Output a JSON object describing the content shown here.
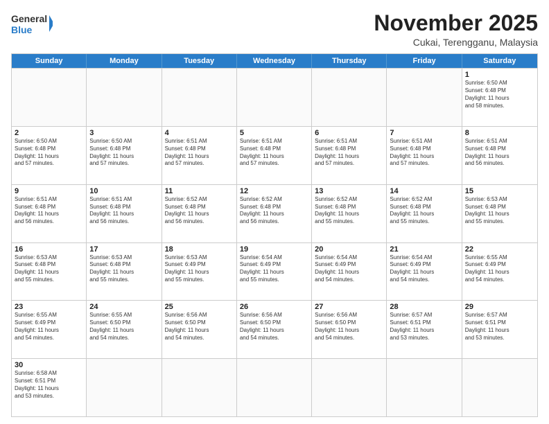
{
  "header": {
    "logo_general": "General",
    "logo_blue": "Blue",
    "month_title": "November 2025",
    "location": "Cukai, Terengganu, Malaysia"
  },
  "weekdays": [
    "Sunday",
    "Monday",
    "Tuesday",
    "Wednesday",
    "Thursday",
    "Friday",
    "Saturday"
  ],
  "weeks": [
    [
      {
        "day": "",
        "info": ""
      },
      {
        "day": "",
        "info": ""
      },
      {
        "day": "",
        "info": ""
      },
      {
        "day": "",
        "info": ""
      },
      {
        "day": "",
        "info": ""
      },
      {
        "day": "",
        "info": ""
      },
      {
        "day": "1",
        "info": "Sunrise: 6:50 AM\nSunset: 6:48 PM\nDaylight: 11 hours\nand 58 minutes."
      }
    ],
    [
      {
        "day": "2",
        "info": "Sunrise: 6:50 AM\nSunset: 6:48 PM\nDaylight: 11 hours\nand 57 minutes."
      },
      {
        "day": "3",
        "info": "Sunrise: 6:50 AM\nSunset: 6:48 PM\nDaylight: 11 hours\nand 57 minutes."
      },
      {
        "day": "4",
        "info": "Sunrise: 6:51 AM\nSunset: 6:48 PM\nDaylight: 11 hours\nand 57 minutes."
      },
      {
        "day": "5",
        "info": "Sunrise: 6:51 AM\nSunset: 6:48 PM\nDaylight: 11 hours\nand 57 minutes."
      },
      {
        "day": "6",
        "info": "Sunrise: 6:51 AM\nSunset: 6:48 PM\nDaylight: 11 hours\nand 57 minutes."
      },
      {
        "day": "7",
        "info": "Sunrise: 6:51 AM\nSunset: 6:48 PM\nDaylight: 11 hours\nand 57 minutes."
      },
      {
        "day": "8",
        "info": "Sunrise: 6:51 AM\nSunset: 6:48 PM\nDaylight: 11 hours\nand 56 minutes."
      }
    ],
    [
      {
        "day": "9",
        "info": "Sunrise: 6:51 AM\nSunset: 6:48 PM\nDaylight: 11 hours\nand 56 minutes."
      },
      {
        "day": "10",
        "info": "Sunrise: 6:51 AM\nSunset: 6:48 PM\nDaylight: 11 hours\nand 56 minutes."
      },
      {
        "day": "11",
        "info": "Sunrise: 6:52 AM\nSunset: 6:48 PM\nDaylight: 11 hours\nand 56 minutes."
      },
      {
        "day": "12",
        "info": "Sunrise: 6:52 AM\nSunset: 6:48 PM\nDaylight: 11 hours\nand 56 minutes."
      },
      {
        "day": "13",
        "info": "Sunrise: 6:52 AM\nSunset: 6:48 PM\nDaylight: 11 hours\nand 55 minutes."
      },
      {
        "day": "14",
        "info": "Sunrise: 6:52 AM\nSunset: 6:48 PM\nDaylight: 11 hours\nand 55 minutes."
      },
      {
        "day": "15",
        "info": "Sunrise: 6:53 AM\nSunset: 6:48 PM\nDaylight: 11 hours\nand 55 minutes."
      }
    ],
    [
      {
        "day": "16",
        "info": "Sunrise: 6:53 AM\nSunset: 6:48 PM\nDaylight: 11 hours\nand 55 minutes."
      },
      {
        "day": "17",
        "info": "Sunrise: 6:53 AM\nSunset: 6:48 PM\nDaylight: 11 hours\nand 55 minutes."
      },
      {
        "day": "18",
        "info": "Sunrise: 6:53 AM\nSunset: 6:49 PM\nDaylight: 11 hours\nand 55 minutes."
      },
      {
        "day": "19",
        "info": "Sunrise: 6:54 AM\nSunset: 6:49 PM\nDaylight: 11 hours\nand 55 minutes."
      },
      {
        "day": "20",
        "info": "Sunrise: 6:54 AM\nSunset: 6:49 PM\nDaylight: 11 hours\nand 54 minutes."
      },
      {
        "day": "21",
        "info": "Sunrise: 6:54 AM\nSunset: 6:49 PM\nDaylight: 11 hours\nand 54 minutes."
      },
      {
        "day": "22",
        "info": "Sunrise: 6:55 AM\nSunset: 6:49 PM\nDaylight: 11 hours\nand 54 minutes."
      }
    ],
    [
      {
        "day": "23",
        "info": "Sunrise: 6:55 AM\nSunset: 6:49 PM\nDaylight: 11 hours\nand 54 minutes."
      },
      {
        "day": "24",
        "info": "Sunrise: 6:55 AM\nSunset: 6:50 PM\nDaylight: 11 hours\nand 54 minutes."
      },
      {
        "day": "25",
        "info": "Sunrise: 6:56 AM\nSunset: 6:50 PM\nDaylight: 11 hours\nand 54 minutes."
      },
      {
        "day": "26",
        "info": "Sunrise: 6:56 AM\nSunset: 6:50 PM\nDaylight: 11 hours\nand 54 minutes."
      },
      {
        "day": "27",
        "info": "Sunrise: 6:56 AM\nSunset: 6:50 PM\nDaylight: 11 hours\nand 54 minutes."
      },
      {
        "day": "28",
        "info": "Sunrise: 6:57 AM\nSunset: 6:51 PM\nDaylight: 11 hours\nand 53 minutes."
      },
      {
        "day": "29",
        "info": "Sunrise: 6:57 AM\nSunset: 6:51 PM\nDaylight: 11 hours\nand 53 minutes."
      }
    ],
    [
      {
        "day": "30",
        "info": "Sunrise: 6:58 AM\nSunset: 6:51 PM\nDaylight: 11 hours\nand 53 minutes."
      },
      {
        "day": "",
        "info": ""
      },
      {
        "day": "",
        "info": ""
      },
      {
        "day": "",
        "info": ""
      },
      {
        "day": "",
        "info": ""
      },
      {
        "day": "",
        "info": ""
      },
      {
        "day": "",
        "info": ""
      }
    ]
  ]
}
